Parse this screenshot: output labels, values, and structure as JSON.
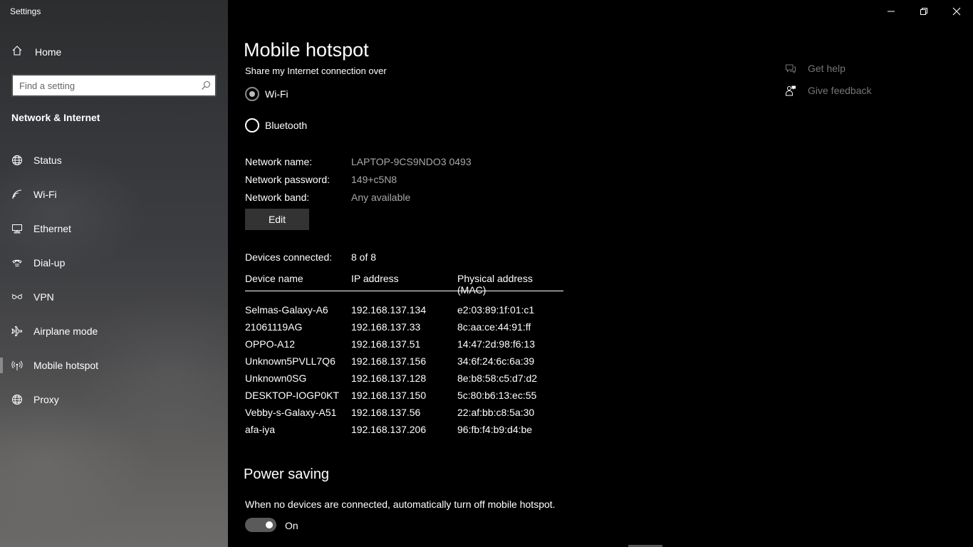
{
  "window": {
    "title": "Settings"
  },
  "sidebar": {
    "home_label": "Home",
    "search": {
      "placeholder": "Find a setting",
      "value": ""
    },
    "section_title": "Network & Internet",
    "items": [
      {
        "label": "Status",
        "icon": "globe-icon"
      },
      {
        "label": "Wi-Fi",
        "icon": "wifi-icon"
      },
      {
        "label": "Ethernet",
        "icon": "ethernet-icon"
      },
      {
        "label": "Dial-up",
        "icon": "dialup-icon"
      },
      {
        "label": "VPN",
        "icon": "vpn-icon"
      },
      {
        "label": "Airplane mode",
        "icon": "airplane-icon"
      },
      {
        "label": "Mobile hotspot",
        "icon": "hotspot-icon",
        "active": true
      },
      {
        "label": "Proxy",
        "icon": "globe-icon"
      }
    ]
  },
  "main": {
    "title": "Mobile hotspot",
    "share_over_label": "Share my Internet connection over",
    "share_options": [
      {
        "label": "Wi-Fi",
        "selected": true
      },
      {
        "label": "Bluetooth",
        "selected": false
      }
    ],
    "network": {
      "name_label": "Network name:",
      "name_value": "LAPTOP-9CS9NDO3 0493",
      "password_label": "Network password:",
      "password_value": "149+c5N8",
      "band_label": "Network band:",
      "band_value": "Any available"
    },
    "edit_label": "Edit",
    "devices_label": "Devices connected:",
    "devices_count": "8 of 8",
    "columns": [
      "Device name",
      "IP address",
      "Physical address (MAC)"
    ],
    "devices": [
      [
        "Selmas-Galaxy-A6",
        "192.168.137.134",
        "e2:03:89:1f:01:c1"
      ],
      [
        "21061119AG",
        "192.168.137.33",
        "8c:aa:ce:44:91:ff"
      ],
      [
        "OPPO-A12",
        "192.168.137.51",
        "14:47:2d:98:f6:13"
      ],
      [
        "Unknown5PVLL7Q6",
        "192.168.137.156",
        "34:6f:24:6c:6a:39"
      ],
      [
        "Unknown0SG",
        "192.168.137.128",
        "8e:b8:58:c5:d7:d2"
      ],
      [
        "DESKTOP-IOGP0KT",
        "192.168.137.150",
        "5c:80:b6:13:ec:55"
      ],
      [
        "Vebby-s-Galaxy-A51",
        "192.168.137.56",
        "22:af:bb:c8:5a:30"
      ],
      [
        "afa-iya",
        "192.168.137.206",
        "96:fb:f4:b9:d4:be"
      ]
    ],
    "power_saving": {
      "title": "Power saving",
      "description": "When no devices are connected, automatically turn off mobile hotspot.",
      "toggle_state": "On",
      "toggle_on": true
    }
  },
  "help": {
    "get_help_label": "Get help",
    "give_feedback_label": "Give feedback"
  }
}
